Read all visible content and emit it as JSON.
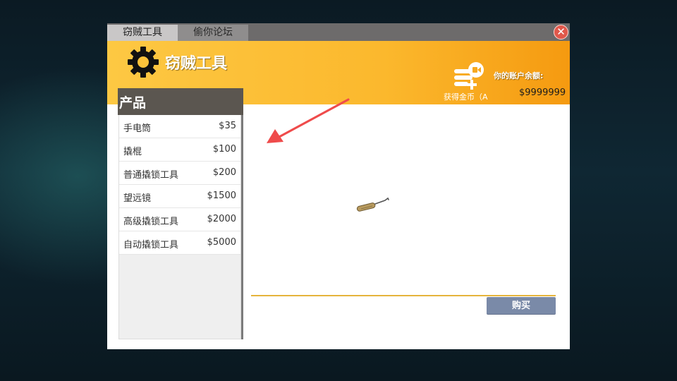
{
  "tabs": [
    {
      "label": "窃贼工具",
      "active": true
    },
    {
      "label": "偷你论坛",
      "active": false
    }
  ],
  "header": {
    "title": "窃贼工具",
    "coin_button_label": "获得金币（A",
    "balance_label": "你的账户余额:",
    "balance_value": "$9999999"
  },
  "sidebar": {
    "title": "产品",
    "items": [
      {
        "name": "手电筒",
        "price": "$35"
      },
      {
        "name": "撬棍",
        "price": "$100"
      },
      {
        "name": "普通撬锁工具",
        "price": "$200"
      },
      {
        "name": "望远镜",
        "price": "$1500"
      },
      {
        "name": "高级撬锁工具",
        "price": "$2000"
      },
      {
        "name": "自动撬锁工具",
        "price": "$5000"
      }
    ]
  },
  "buy_button": {
    "label": "购买"
  },
  "icons": {
    "close": "close-icon",
    "gear": "gear-icon",
    "coin_video": "coin-video-icon",
    "arrow": "arrow-icon",
    "product": "lockpick-icon"
  },
  "colors": {
    "header_start": "#fdc843",
    "header_end": "#f59a10",
    "sidebar_header": "#5b5650",
    "buy_button": "#7a8aa8",
    "close_button": "#e0584b",
    "arrow": "#ef4b4b"
  }
}
